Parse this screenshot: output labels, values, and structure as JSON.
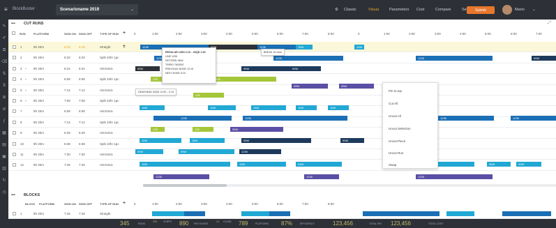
{
  "topbar": {
    "logo_glyph": "≡",
    "brand": "BlockBuster",
    "scenario": "Scenarioname 2019",
    "nav": [
      "Classic",
      "Visual",
      "Parameters",
      "Cost",
      "Compare",
      "Settings"
    ],
    "active_nav": "Visual",
    "submit_label": "Submit",
    "user_name": "Mario"
  },
  "colors": {
    "blue": "#1b6fb5",
    "cyan": "#21a8d4",
    "navy": "#1d3a5c",
    "purple": "#5a4fa5",
    "lime": "#a4c639",
    "dark_gray_bar": "#2d3137",
    "accent_orange": "#e8772e"
  },
  "cut_runs": {
    "title": "CUT RUNS",
    "columns": [
      "RUN",
      "PLATFORM",
      "SIGN ON",
      "SIGN OFF",
      "TYPE OF RUN"
    ],
    "hours_left": [
      "0",
      "1:00",
      "2:00",
      "3:00",
      "4:00",
      "5:00",
      "6:00",
      "7:00",
      "8:00"
    ],
    "hours_right": [
      "0",
      "1:00",
      "2:00",
      "3:00",
      "4:00",
      "5:00",
      "6:00",
      "7:00"
    ],
    "rows": [
      {
        "run": "1",
        "platform": "8h 20m",
        "on": "6:18",
        "off": "6:18",
        "type": "Straight"
      },
      {
        "run": "2",
        "platform": "8h 20m",
        "on": "6:33",
        "off": "6:33",
        "type": "Split 10hr 1pc"
      },
      {
        "run": "3",
        "platform": "8h 20m",
        "on": "6:24",
        "off": "6:24",
        "type": "AM Extra"
      },
      {
        "run": "4",
        "platform": "8h 20m",
        "on": "6:08",
        "off": "6:08",
        "type": "Split 10hr 1pc"
      },
      {
        "run": "5",
        "platform": "8h 20m",
        "on": "7:12",
        "off": "7:12",
        "type": "AM Extra"
      },
      {
        "run": "6",
        "platform": "8h 20m",
        "on": "7:08",
        "off": "7:08",
        "type": "Split 10hr 1pc"
      },
      {
        "run": "7",
        "platform": "8h 20m",
        "on": "6:08",
        "off": "6:08",
        "type": "AM Extra"
      },
      {
        "run": "8",
        "platform": "8h 20m",
        "on": "7:14",
        "off": "7:14",
        "type": "Split 10hr 1pc"
      },
      {
        "run": "9",
        "platform": "8h 20m",
        "on": "6:28",
        "off": "6:28",
        "type": "AM Extra"
      },
      {
        "run": "10",
        "platform": "8h 20m",
        "on": "6:38",
        "off": "6:38",
        "type": "Split 10hr 1pc"
      },
      {
        "run": "11",
        "platform": "8h 20m",
        "on": "7:30",
        "off": "7:30",
        "type": "AM Extra"
      },
      {
        "run": "12",
        "platform": "8h 20m",
        "on": "7:45",
        "off": "7:45",
        "type": "AM Extra"
      }
    ]
  },
  "blocks": {
    "title": "BLOCKS",
    "columns": [
      "BLOCK",
      "PLATFORM",
      "SIGN ON",
      "SIGN OFF",
      "TYPE OF RUN"
    ],
    "hours": [
      "0",
      "1:00",
      "2:00",
      "3:00",
      "4:00",
      "5:00",
      "6:00",
      "7:00",
      "8:00"
    ],
    "rows": [
      {
        "run": "1",
        "platform": "8h 20m",
        "on": "7:45",
        "off": "7:45",
        "type": "Straight"
      }
    ]
  },
  "tooltip": {
    "title": "REGULAR 12DS 6:10 – 00QD 1:45",
    "lines": [
      "LINE 1235",
      "PATTERN 15IW",
      "TRIPID 7603097",
      "PREVIOUS NODE 12:15",
      "NEXT NODE 3:10"
    ]
  },
  "tip_break": "BREAK 15 mins",
  "tip_deadhead": "DEADHEAD 00QD 11:00 – 0:14",
  "context_menu": [
    "Pin to top",
    "Cut All",
    "Uncut All",
    "Uncut Selection",
    "Uncut Piece",
    "Uncut Run",
    "Swap"
  ],
  "footer": {
    "runs_value": "345",
    "runs_label": "RUNS",
    "a_value": "378",
    "a_label": "24 BPS",
    "b_value": "890",
    "b_label": "PAY HOURS",
    "c_value": "14",
    "c_label": "CLEAR",
    "platform_value": "789",
    "platform_label": "PLATFORM",
    "eff_value": "87%",
    "eff_label": "EFFICIENCY",
    "pay_value": "123,456",
    "pay_label": "TOTAL PAY",
    "cost_value": "123,456",
    "cost_label": "TOTAL COST"
  }
}
